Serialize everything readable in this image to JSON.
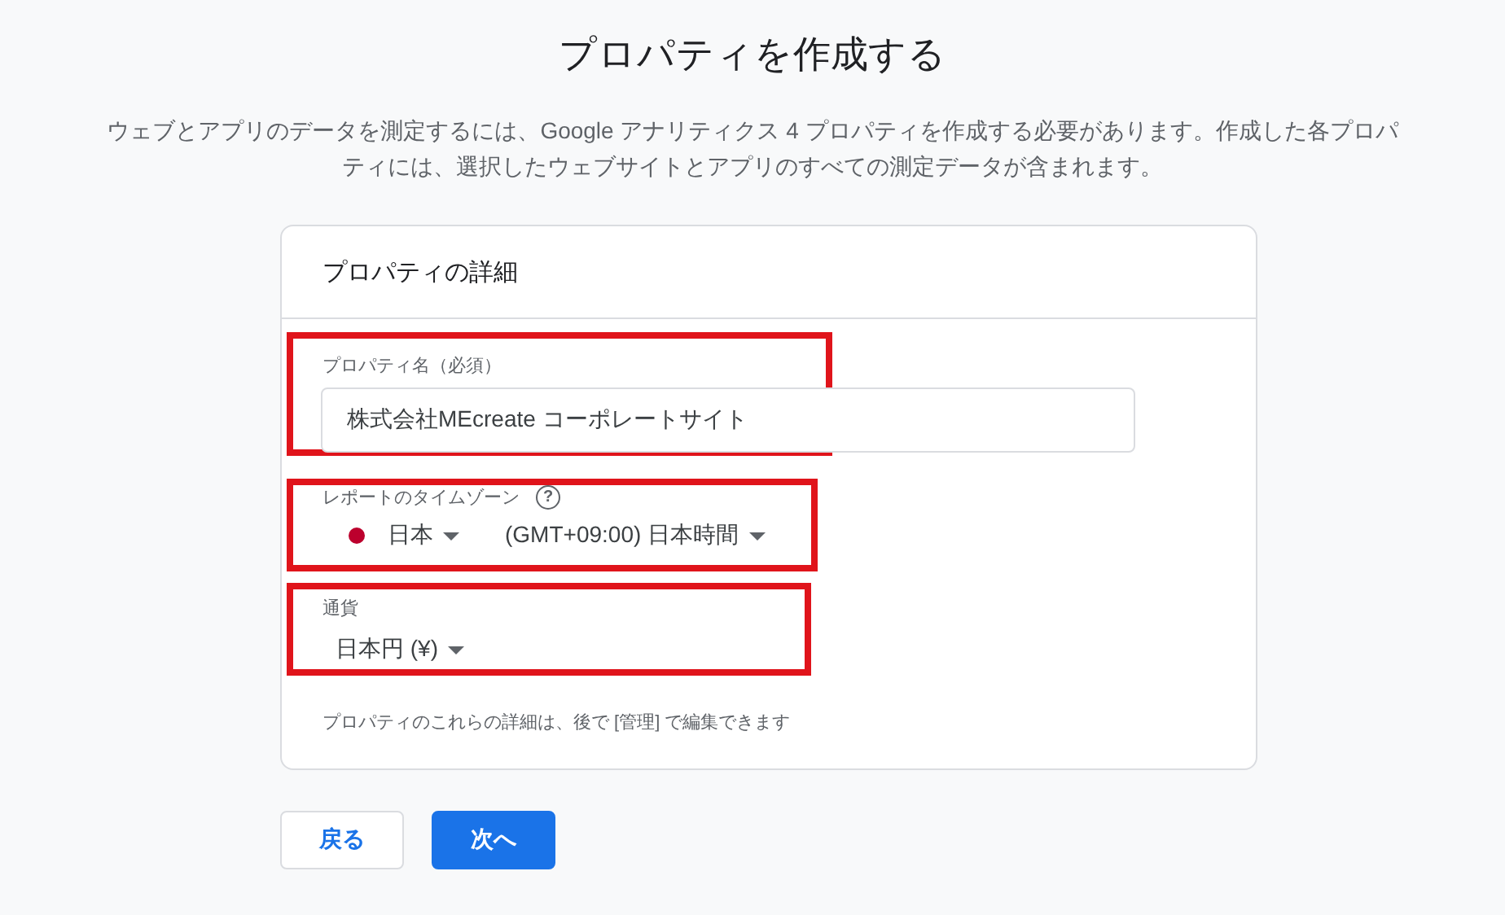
{
  "title": "プロパティを作成する",
  "description": "ウェブとアプリのデータを測定するには、Google アナリティクス 4 プロパティを作成する必要があります。作成した各プロパティには、選択したウェブサイトとアプリのすべての測定データが含まれます。",
  "card": {
    "heading": "プロパティの詳細",
    "fields": [
      {
        "kind": "text",
        "label": "プロパティ名（必須）",
        "value": "株式会社MEcreate コーポレートサイト",
        "highlighted": true
      },
      {
        "kind": "timezone",
        "label": "レポートのタイムゾーン",
        "help_icon": "?",
        "country": "日本",
        "timezone": "(GMT+09:00) 日本時間",
        "highlighted": true
      },
      {
        "kind": "select",
        "label": "通貨",
        "value": "日本円 (¥)",
        "highlighted": true
      }
    ],
    "note": "プロパティのこれらの詳細は、後で [管理] で編集できます"
  },
  "buttons": [
    {
      "label": "戻る",
      "kind": "secondary"
    },
    {
      "label": "次へ",
      "kind": "primary"
    }
  ]
}
